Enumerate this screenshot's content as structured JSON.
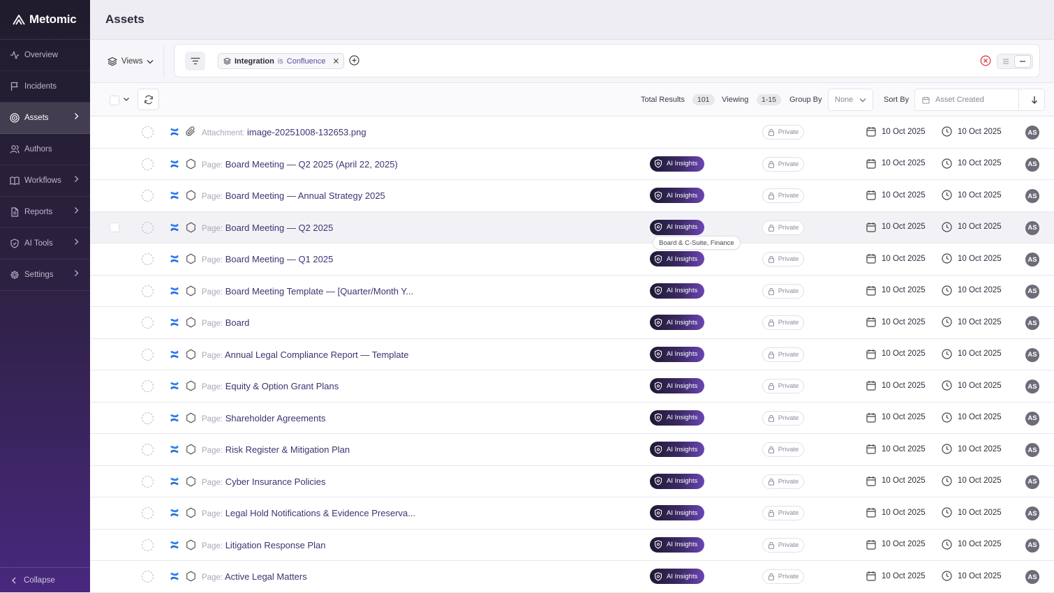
{
  "app": {
    "name": "Metomic"
  },
  "sidebar": {
    "items": [
      {
        "label": "Overview",
        "icon": "activity-icon",
        "chevron": false
      },
      {
        "label": "Incidents",
        "icon": "flag-icon",
        "chevron": false
      },
      {
        "label": "Assets",
        "icon": "target-icon",
        "chevron": true,
        "active": true
      },
      {
        "label": "Authors",
        "icon": "users-icon",
        "chevron": false
      },
      {
        "label": "Workflows",
        "icon": "book-icon",
        "chevron": true
      },
      {
        "label": "Reports",
        "icon": "file-icon",
        "chevron": true
      },
      {
        "label": "AI Tools",
        "icon": "shield-icon",
        "chevron": true
      },
      {
        "label": "Settings",
        "icon": "gear-icon",
        "chevron": true
      }
    ],
    "collapse_label": "Collapse"
  },
  "header": {
    "title": "Assets"
  },
  "filters": {
    "views_label": "Views",
    "chip": {
      "key": "Integration",
      "operator": "is",
      "value": "Confluence"
    }
  },
  "toolbar": {
    "total_label": "Total Results",
    "total_value": "101",
    "viewing_label": "Viewing",
    "viewing_value": "1-15",
    "group_label": "Group By",
    "group_value": "None",
    "sort_label": "Sort By",
    "sort_value": "Asset Created"
  },
  "badges": {
    "ai": "AI Insights",
    "private": "Private"
  },
  "tooltip": {
    "text": "Board & C-Suite, Finance"
  },
  "rows": [
    {
      "prefix": "Attachment:",
      "title": "image-20251008-132653.png",
      "type": "attachment",
      "ai": false,
      "created": "10 Oct 2025",
      "updated": "10 Oct 2025",
      "avatar": "AS"
    },
    {
      "prefix": "Page:",
      "title": "Board Meeting — Q2 2025 (April 22, 2025)",
      "type": "page",
      "ai": true,
      "created": "10 Oct 2025",
      "updated": "10 Oct 2025",
      "avatar": "AS"
    },
    {
      "prefix": "Page:",
      "title": "Board Meeting — Annual Strategy 2025",
      "type": "page",
      "ai": true,
      "created": "10 Oct 2025",
      "updated": "10 Oct 2025",
      "avatar": "AS"
    },
    {
      "prefix": "Page:",
      "title": "Board Meeting — Q2 2025",
      "type": "page",
      "ai": true,
      "created": "10 Oct 2025",
      "updated": "10 Oct 2025",
      "avatar": "AS",
      "hover": true
    },
    {
      "prefix": "Page:",
      "title": "Board Meeting — Q1 2025",
      "type": "page",
      "ai": true,
      "created": "10 Oct 2025",
      "updated": "10 Oct 2025",
      "avatar": "AS"
    },
    {
      "prefix": "Page:",
      "title": "Board Meeting Template — [Quarter/Month Y...",
      "type": "page",
      "ai": true,
      "created": "10 Oct 2025",
      "updated": "10 Oct 2025",
      "avatar": "AS"
    },
    {
      "prefix": "Page:",
      "title": "Board",
      "type": "page",
      "ai": true,
      "created": "10 Oct 2025",
      "updated": "10 Oct 2025",
      "avatar": "AS"
    },
    {
      "prefix": "Page:",
      "title": "Annual Legal Compliance Report — Template",
      "type": "page",
      "ai": true,
      "created": "10 Oct 2025",
      "updated": "10 Oct 2025",
      "avatar": "AS"
    },
    {
      "prefix": "Page:",
      "title": "Equity & Option Grant Plans",
      "type": "page",
      "ai": true,
      "created": "10 Oct 2025",
      "updated": "10 Oct 2025",
      "avatar": "AS"
    },
    {
      "prefix": "Page:",
      "title": "Shareholder Agreements",
      "type": "page",
      "ai": true,
      "created": "10 Oct 2025",
      "updated": "10 Oct 2025",
      "avatar": "AS"
    },
    {
      "prefix": "Page:",
      "title": "Risk Register & Mitigation Plan",
      "type": "page",
      "ai": true,
      "created": "10 Oct 2025",
      "updated": "10 Oct 2025",
      "avatar": "AS"
    },
    {
      "prefix": "Page:",
      "title": "Cyber Insurance Policies",
      "type": "page",
      "ai": true,
      "created": "10 Oct 2025",
      "updated": "10 Oct 2025",
      "avatar": "AS"
    },
    {
      "prefix": "Page:",
      "title": "Legal Hold Notifications & Evidence Preserva...",
      "type": "page",
      "ai": true,
      "created": "10 Oct 2025",
      "updated": "10 Oct 2025",
      "avatar": "AS"
    },
    {
      "prefix": "Page:",
      "title": "Litigation Response Plan",
      "type": "page",
      "ai": true,
      "created": "10 Oct 2025",
      "updated": "10 Oct 2025",
      "avatar": "AS"
    },
    {
      "prefix": "Page:",
      "title": "Active Legal Matters",
      "type": "page",
      "ai": true,
      "created": "10 Oct 2025",
      "updated": "10 Oct 2025",
      "avatar": "AS"
    }
  ]
}
